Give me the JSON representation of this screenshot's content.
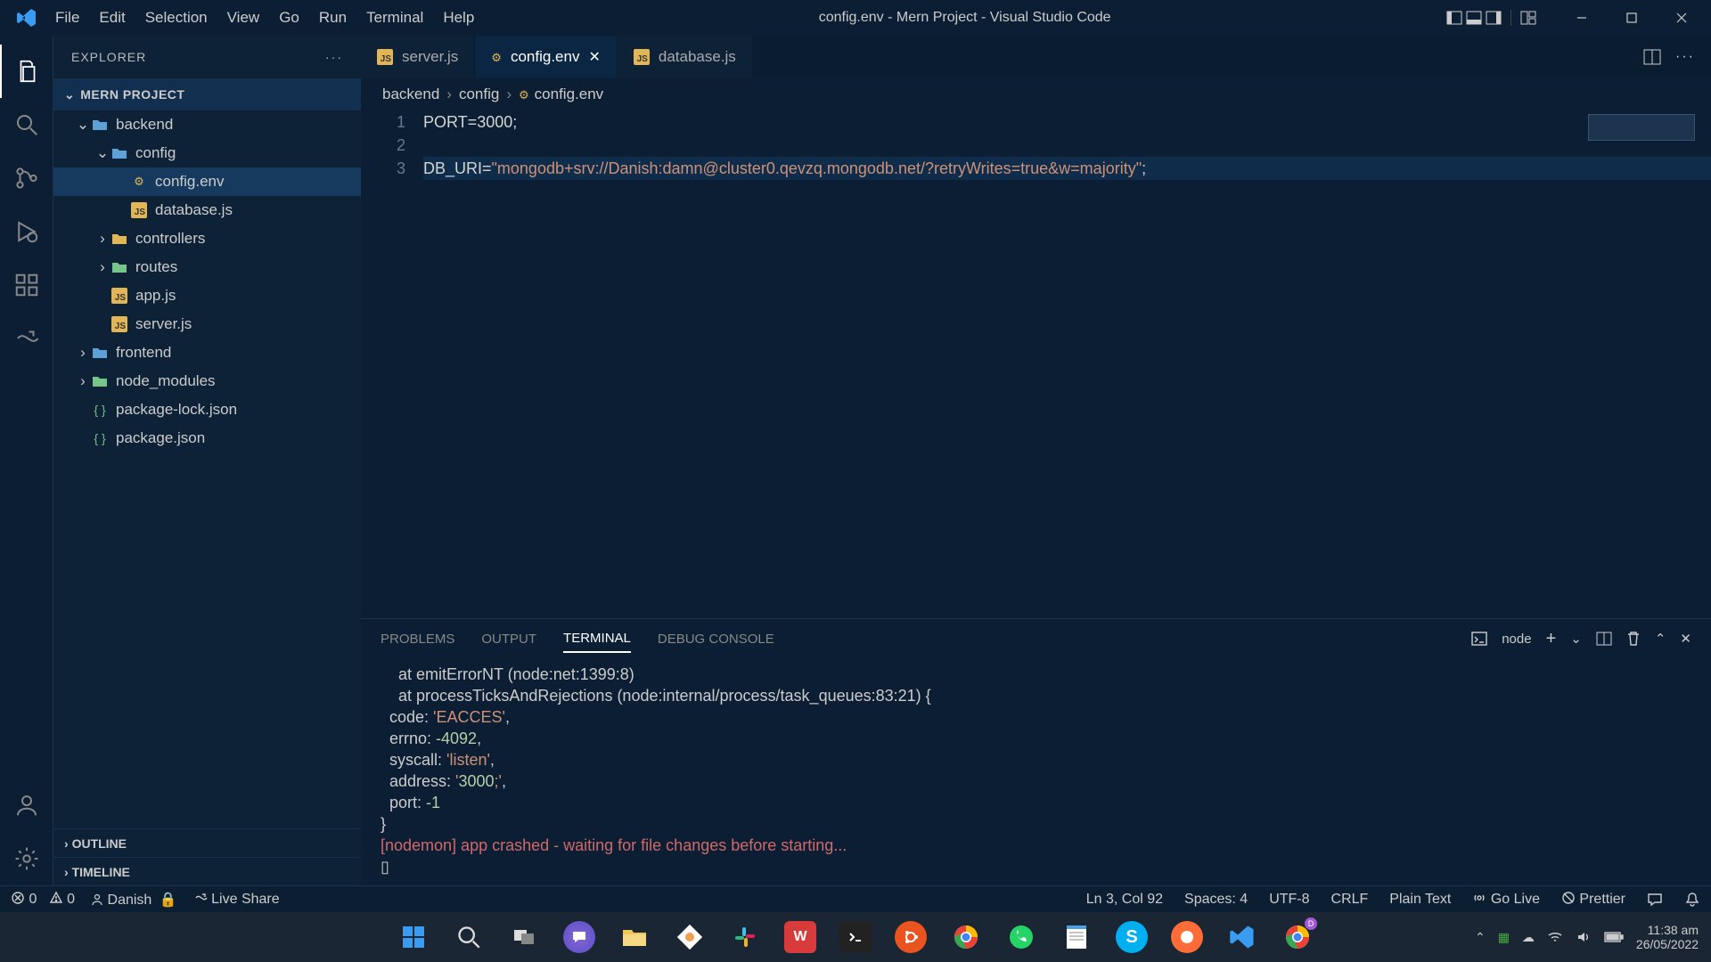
{
  "titlebar": {
    "title": "config.env - Mern Project - Visual Studio Code",
    "menus": [
      "File",
      "Edit",
      "Selection",
      "View",
      "Go",
      "Run",
      "Terminal",
      "Help"
    ]
  },
  "sidebar": {
    "title": "EXPLORER",
    "section": "MERN PROJECT",
    "tree": [
      {
        "label": "backend",
        "indent": 0,
        "kind": "folder-open",
        "chev": "v",
        "color": "#5ea1d6"
      },
      {
        "label": "config",
        "indent": 1,
        "kind": "folder-open",
        "chev": "v",
        "color": "#5ea1d6"
      },
      {
        "label": "config.env",
        "indent": 2,
        "kind": "env",
        "selected": true
      },
      {
        "label": "database.js",
        "indent": 2,
        "kind": "js"
      },
      {
        "label": "controllers",
        "indent": 1,
        "kind": "folder",
        "chev": ">",
        "color": "#e2b556"
      },
      {
        "label": "routes",
        "indent": 1,
        "kind": "folder",
        "chev": ">",
        "color": "#76c58a"
      },
      {
        "label": "app.js",
        "indent": 1,
        "kind": "js"
      },
      {
        "label": "server.js",
        "indent": 1,
        "kind": "js"
      },
      {
        "label": "frontend",
        "indent": 0,
        "kind": "folder",
        "chev": ">",
        "color": "#5ea1d6"
      },
      {
        "label": "node_modules",
        "indent": 0,
        "kind": "folder",
        "chev": ">",
        "color": "#76c58a"
      },
      {
        "label": "package-lock.json",
        "indent": 0,
        "kind": "json"
      },
      {
        "label": "package.json",
        "indent": 0,
        "kind": "json"
      }
    ],
    "outline": "OUTLINE",
    "timeline": "TIMELINE"
  },
  "tabs": [
    {
      "label": "server.js",
      "kind": "js"
    },
    {
      "label": "config.env",
      "kind": "env",
      "active": true,
      "close": true
    },
    {
      "label": "database.js",
      "kind": "js"
    }
  ],
  "breadcrumbs": [
    "backend",
    "config",
    "config.env"
  ],
  "code": {
    "lines": [
      "PORT=3000;",
      "",
      "DB_URI=\"mongodb+srv://Danish:damn@cluster0.qevzq.mongodb.net/?retryWrites=true&w=majority\";"
    ],
    "highlight_index": 2
  },
  "panel": {
    "tabs": [
      "PROBLEMS",
      "OUTPUT",
      "TERMINAL",
      "DEBUG CONSOLE"
    ],
    "active_tab": "TERMINAL",
    "terminal_kind": "node",
    "terminal_lines": [
      {
        "text": "    at emitErrorNT (node:net:1399:8)",
        "class": "white"
      },
      {
        "text": "    at processTicksAndRejections (node:internal/process/task_queues:83:21) {",
        "class": "white"
      },
      {
        "text": "  code: 'EACCES',",
        "class": "orange",
        "quoted": true
      },
      {
        "text": "  errno: -4092,",
        "class": "orange",
        "num": true
      },
      {
        "text": "  syscall: 'listen',",
        "class": "orange",
        "quoted": true
      },
      {
        "text": "  address: '3000;',",
        "class": "orange",
        "quoted": true
      },
      {
        "text": "  port: -1",
        "class": "orange",
        "num": true
      },
      {
        "text": "}",
        "class": "white"
      },
      {
        "text": "[nodemon] app crashed - waiting for file changes before starting...",
        "class": "red"
      },
      {
        "text": "▯",
        "class": "white"
      }
    ]
  },
  "statusbar": {
    "errors": "0",
    "warnings": "0",
    "user": "Danish",
    "liveshare": "Live Share",
    "cursor": "Ln 3, Col 92",
    "spaces": "Spaces: 4",
    "encoding": "UTF-8",
    "eol": "CRLF",
    "language": "Plain Text",
    "golive": "Go Live",
    "prettier": "Prettier"
  },
  "taskbar": {
    "time": "11:38 am",
    "date": "26/05/2022"
  }
}
